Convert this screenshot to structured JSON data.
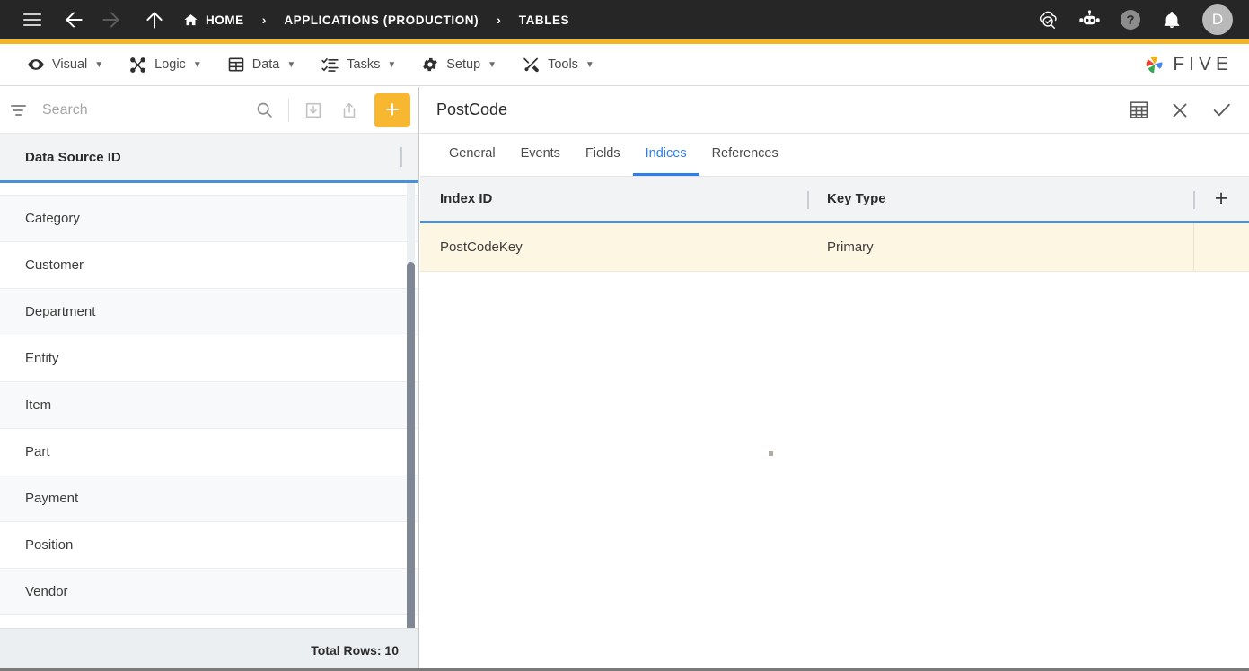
{
  "topbar": {
    "menu_icon": "hamburger-menu-icon",
    "back_icon": "arrow-left-icon",
    "forward_icon": "arrow-right-icon",
    "up_icon": "arrow-up-icon",
    "breadcrumbs": [
      {
        "label": "HOME",
        "icon": "home-icon"
      },
      {
        "label": "APPLICATIONS (PRODUCTION)",
        "icon": ""
      },
      {
        "label": "TABLES",
        "icon": ""
      }
    ],
    "separator": "›",
    "right_icons": [
      {
        "name": "cloud-check-icon"
      },
      {
        "name": "robot-assistant-icon"
      },
      {
        "name": "help-icon",
        "glyph": "?"
      },
      {
        "name": "notifications-bell-icon"
      }
    ],
    "avatar_initial": "D",
    "accent_line_color": "#f5b426"
  },
  "menubar": {
    "items": [
      {
        "label": "Visual",
        "icon": "eye-icon",
        "caret": "▼"
      },
      {
        "label": "Logic",
        "icon": "logic-nodes-icon",
        "caret": "▼"
      },
      {
        "label": "Data",
        "icon": "table-grid-icon",
        "caret": "▼"
      },
      {
        "label": "Tasks",
        "icon": "task-list-icon",
        "caret": "▼"
      },
      {
        "label": "Setup",
        "icon": "gear-icon",
        "caret": "▼"
      },
      {
        "label": "Tools",
        "icon": "tools-wrench-hammer-icon",
        "caret": "▼"
      }
    ],
    "brand_text": "FIVE",
    "brand_icon": "five-pinwheel-logo"
  },
  "sidebar": {
    "search": {
      "value": "",
      "placeholder": "Search"
    },
    "toolbar_icons": [
      {
        "name": "filter-icon"
      },
      {
        "name": "search-icon"
      },
      {
        "name": "import-download-icon"
      },
      {
        "name": "export-share-icon"
      },
      {
        "name": "add-new-button",
        "label": "+"
      }
    ],
    "column_header": "Data Source ID",
    "rows": [
      {
        "label": "Category"
      },
      {
        "label": "Customer"
      },
      {
        "label": "Department"
      },
      {
        "label": "Entity"
      },
      {
        "label": "Item"
      },
      {
        "label": "Part"
      },
      {
        "label": "Payment"
      },
      {
        "label": "Position"
      },
      {
        "label": "Vendor"
      }
    ],
    "footer_total": "Total Rows: 10",
    "accent_color": "#4a90d9"
  },
  "detail": {
    "title": "PostCode",
    "actions": [
      {
        "name": "grid-table-view-icon"
      },
      {
        "name": "close-icon",
        "glyph": "✕"
      },
      {
        "name": "save-check-icon",
        "glyph": "✓"
      }
    ],
    "tabs": [
      {
        "label": "General",
        "active": false
      },
      {
        "label": "Events",
        "active": false
      },
      {
        "label": "Fields",
        "active": false
      },
      {
        "label": "Indices",
        "active": true
      },
      {
        "label": "References",
        "active": false
      }
    ],
    "grid": {
      "columns": [
        {
          "label": "Index ID"
        },
        {
          "label": "Key Type"
        },
        {
          "label": ""
        }
      ],
      "add_row_label": "+",
      "rows": [
        {
          "index_id": "PostCodeKey",
          "key_type": "Primary",
          "selected": true
        }
      ],
      "selected_row_color": "#fdf6e3",
      "accent_color": "#4a90d9"
    }
  }
}
